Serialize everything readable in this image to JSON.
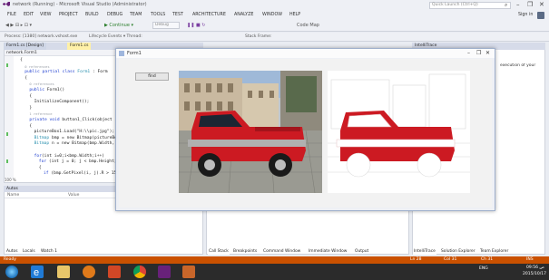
{
  "titlebar": {
    "title": "network (Running) - Microsoft Visual Studio (Administrator)",
    "quick_launch": "Quick Launch (Ctrl+Q)",
    "search_glyph": "⌕",
    "minimize": "–",
    "maximize": "❐",
    "close": "✕"
  },
  "menu": {
    "items": [
      "FILE",
      "EDIT",
      "VIEW",
      "PROJECT",
      "BUILD",
      "DEBUG",
      "TEAM",
      "TOOLS",
      "TEST",
      "ARCHITECTURE",
      "ANALYZE",
      "WINDOW",
      "HELP"
    ],
    "sign_in": "Sign in"
  },
  "toolbar": {
    "nav_glyphs": "◀ ▶ ⊟ ▸ ⊡ ▾",
    "continue_label": "▶ Continue ▾",
    "debug_dropdown": "Debug",
    "code_map": "Code Map"
  },
  "procbar": {
    "process": "Process: [1380] network.vshost.exe",
    "lifecycle": "Lifecycle Events ▾ Thread:",
    "stack_frame": "Stack Frame:"
  },
  "editor": {
    "tabs": [
      "Form1.cs [Design]",
      "Form1.cs"
    ],
    "nav_left": "network.Form1",
    "zoom": "100 %",
    "lines": [
      {
        "indent": 1,
        "text": "{"
      },
      {
        "indent": 2,
        "text": "0 references",
        "ref": true
      },
      {
        "indent": 2,
        "kw": "public partial class",
        "ty": "Form1",
        "rest": " : Form"
      },
      {
        "indent": 2,
        "text": "{"
      },
      {
        "indent": 3,
        "text": "0 references",
        "ref": true
      },
      {
        "indent": 3,
        "kw": "public",
        "rest": " Form1()"
      },
      {
        "indent": 3,
        "text": "{"
      },
      {
        "indent": 4,
        "text": "InitializeComponent();"
      },
      {
        "indent": 3,
        "text": "}"
      },
      {
        "indent": 3,
        "text": "1 reference",
        "ref": true
      },
      {
        "indent": 3,
        "kw": "private void",
        "rest": " button1_Click(object sender, EventArgs e)"
      },
      {
        "indent": 3,
        "text": "{"
      },
      {
        "indent": 4,
        "text": "pictureBox1.Load(\"H:\\\\pic.jpg\");"
      },
      {
        "indent": 4,
        "ty": "Bitmap",
        "rest": " bmp = new Bitmap(pictureBox1.Image);"
      },
      {
        "indent": 4,
        "ty": "Bitmap",
        "rest": " n = new Bitmap(bmp.Width, bmp.Height);"
      },
      {
        "indent": 4,
        "text": ""
      },
      {
        "indent": 4,
        "kw": "for",
        "rest": "(int i=0;i<bmp.Width;i++)"
      },
      {
        "indent": 5,
        "kw": "for",
        "rest": " (int j = 0; j < bmp.Height; j++)"
      },
      {
        "indent": 5,
        "text": "{"
      },
      {
        "indent": 6,
        "kw": "if",
        "rest": " (bmp.GetPixel(i, j).R > 150)"
      }
    ]
  },
  "autos": {
    "title": "Autos",
    "col_name": "Name",
    "col_value": "Value"
  },
  "bottom_tabs_left": [
    "Autos",
    "Locals",
    "Watch 1"
  ],
  "bottom_tabs_center": [
    "Call Stack",
    "Breakpoints",
    "Command Window",
    "Immediate Window",
    "Output"
  ],
  "bottom_tabs_right": [
    "IntelliTrace",
    "Solution Explorer",
    "Team Explorer"
  ],
  "right_pane": {
    "title": "IntelliTrace",
    "text": "execution of your"
  },
  "status": {
    "left": "Ready",
    "ln": "Ln 28",
    "col": "Col 31",
    "ch": "Ch 31",
    "mode": "INS"
  },
  "taskbar": {
    "time": "09:56 ص",
    "date": "2015/10/17",
    "lang": "ENG",
    "icons": [
      "start",
      "ie",
      "explorer",
      "media-player",
      "powerpoint",
      "chrome",
      "visual-studio",
      "app"
    ]
  },
  "form1": {
    "title": "Form1",
    "button_label": "find"
  },
  "colors": {
    "status_bar": "#ca5100",
    "car_red": "#cc1a22",
    "accent_blue": "#007acc"
  }
}
